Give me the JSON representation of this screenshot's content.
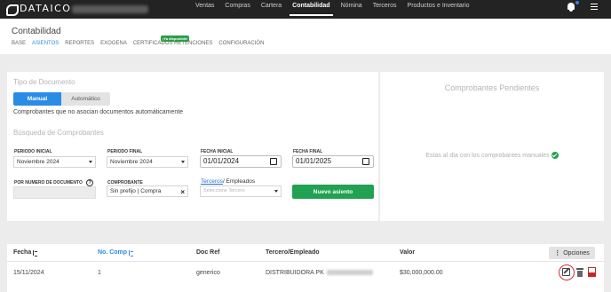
{
  "app": {
    "logo_text": "DATAICO",
    "company_name": "SCOPTI MARKET S.A.S."
  },
  "topnav": {
    "items": [
      {
        "label": "Ventas",
        "active": false
      },
      {
        "label": "Compras",
        "active": false
      },
      {
        "label": "Cartera",
        "active": false
      },
      {
        "label": "Contabilidad",
        "active": true
      },
      {
        "label": "Nómina",
        "active": false
      },
      {
        "label": "Terceros",
        "active": false
      },
      {
        "label": "Productos e Inventario",
        "active": false
      }
    ]
  },
  "page": {
    "title": "Contabilidad",
    "subtabs": [
      {
        "label": "BASE",
        "active": false
      },
      {
        "label": "ASIENTOS",
        "active": true
      },
      {
        "label": "REPORTES",
        "active": false
      },
      {
        "label": "EXOGENA",
        "active": false
      },
      {
        "label": "CERTIFICADOS RETENCIONES",
        "active": false
      },
      {
        "label": "CONFIGURACIÓN",
        "active": false
      }
    ],
    "new_badge": "¡Ya disponible!"
  },
  "document_form": {
    "section_title": "Tipo de Documento",
    "toggle": {
      "manual": "Manual",
      "automatic": "Automático",
      "selected": "Manual"
    },
    "description": "Comprobantes que no asocian documentos automáticamente",
    "search_title": "Búsqueda de Comprobantes",
    "periodo_inicial": {
      "label": "PERIODO INICIAL",
      "value": "Noviembre 2024"
    },
    "periodo_final": {
      "label": "PERIODO FINAL",
      "value": "Noviembre 2024"
    },
    "fecha_inicial": {
      "label": "FECHA INICIAL",
      "value": "01/01/2024"
    },
    "fecha_final": {
      "label": "FECHA FINAL",
      "value": "01/01/2025"
    },
    "por_numero": {
      "label": "POR NUMERO DE DOCUMENTO",
      "help": "?"
    },
    "comprobante": {
      "label": "COMPROBANTE",
      "value": "Sin prefijo | Compra"
    },
    "tercero": {
      "link_label": "Terceros",
      "rest_label": "/ Empleados",
      "placeholder": "Seleccione Tercero"
    },
    "new_button": "Nuevo asiento"
  },
  "pending": {
    "title": "Comprobantes Pendientes",
    "message": "Estas al día con los comprobantes manuales"
  },
  "table": {
    "headers": {
      "fecha": "Fecha",
      "no_comp": "No. Comp",
      "doc_ref": "Doc Ref",
      "tercero": "Tercero/Empleado",
      "valor": "Valor"
    },
    "options_button": "Opciones",
    "rows": [
      {
        "fecha": "15/11/2024",
        "no_comp": "1",
        "doc_ref": "generico",
        "tercero": "DISTRIBUIDORA PK",
        "valor": "$30,000,000.00"
      }
    ]
  },
  "colors": {
    "topbar": "#232323",
    "accent_blue": "#2b8ce6",
    "success_green": "#21a152",
    "danger_red": "#d32f2f"
  }
}
